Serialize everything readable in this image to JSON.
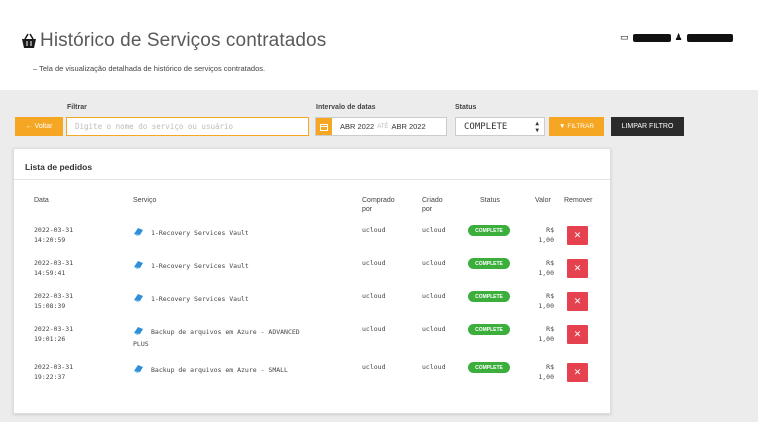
{
  "header": {
    "title": "Histórico de Serviços contratados",
    "subtitle": "– Tela de visualização detalhada de histórico de serviços contratados."
  },
  "filters": {
    "filter_label": "Filtrar",
    "date_label": "Intervalo de datas",
    "status_label": "Status",
    "back_label": "Voltar",
    "search_placeholder": "Digite o nome do serviço ou usuário",
    "date_start": "ABR 2022",
    "date_sep": "ATÉ",
    "date_end": "ABR 2022",
    "status_value": "COMPLETE",
    "filter_button": "FILTRAR",
    "clear_button": "LIMPAR FILTRO"
  },
  "orders": {
    "title": "Lista de pedidos",
    "columns": {
      "data": "Data",
      "servico": "Serviço",
      "comprado": "Comprado por",
      "criado": "Criado por",
      "status": "Status",
      "valor": "Valor",
      "remover": "Remover"
    },
    "rows": [
      {
        "date": "2022-03-31",
        "time": "14:20:59",
        "service": "1-Recovery Services Vault",
        "bought_by": "ucloud",
        "created_by": "ucloud",
        "status": "COMPLETE",
        "currency": "R$",
        "amount": "1,00"
      },
      {
        "date": "2022-03-31",
        "time": "14:59:41",
        "service": "1-Recovery Services Vault",
        "bought_by": "ucloud",
        "created_by": "ucloud",
        "status": "COMPLETE",
        "currency": "R$",
        "amount": "1,00"
      },
      {
        "date": "2022-03-31",
        "time": "15:08:39",
        "service": "1-Recovery Services Vault",
        "bought_by": "ucloud",
        "created_by": "ucloud",
        "status": "COMPLETE",
        "currency": "R$",
        "amount": "1,00"
      },
      {
        "date": "2022-03-31",
        "time": "19:01:26",
        "service": "Backup de arquivos em Azure - ADVANCED PLUS",
        "bought_by": "ucloud",
        "created_by": "ucloud",
        "status": "COMPLETE",
        "currency": "R$",
        "amount": "1,00"
      },
      {
        "date": "2022-03-31",
        "time": "19:22:37",
        "service": "Backup de arquivos em Azure - SMALL",
        "bought_by": "ucloud",
        "created_by": "ucloud",
        "status": "COMPLETE",
        "currency": "R$",
        "amount": "1,00"
      }
    ]
  },
  "colors": {
    "accent": "#f5a623",
    "dark_button": "#2b2b2b",
    "complete_badge": "#3cae3c",
    "remove_button": "#e5414f",
    "service_icon": "#2f8fd8"
  },
  "icons": {
    "title": "shopping-basket-icon",
    "back": "arrow-left-icon",
    "calendar": "calendar-icon",
    "filter": "filter-icon",
    "service": "cloud-service-icon",
    "remove": "close-icon"
  }
}
